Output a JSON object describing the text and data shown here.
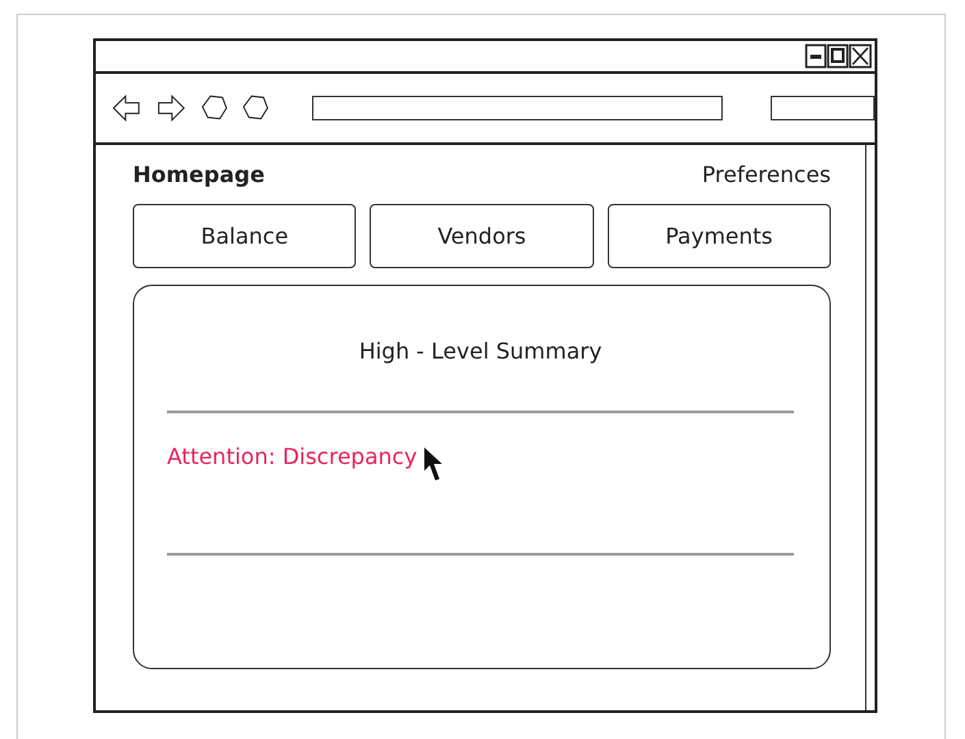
{
  "page": {
    "title": "Homepage",
    "link": "Preferences"
  },
  "nav_buttons": [
    {
      "label": "Balance"
    },
    {
      "label": "Vendors"
    },
    {
      "label": "Payments"
    }
  ],
  "summary": {
    "title": "High - Level Summary",
    "alert": "Attention: Discrepancy"
  }
}
